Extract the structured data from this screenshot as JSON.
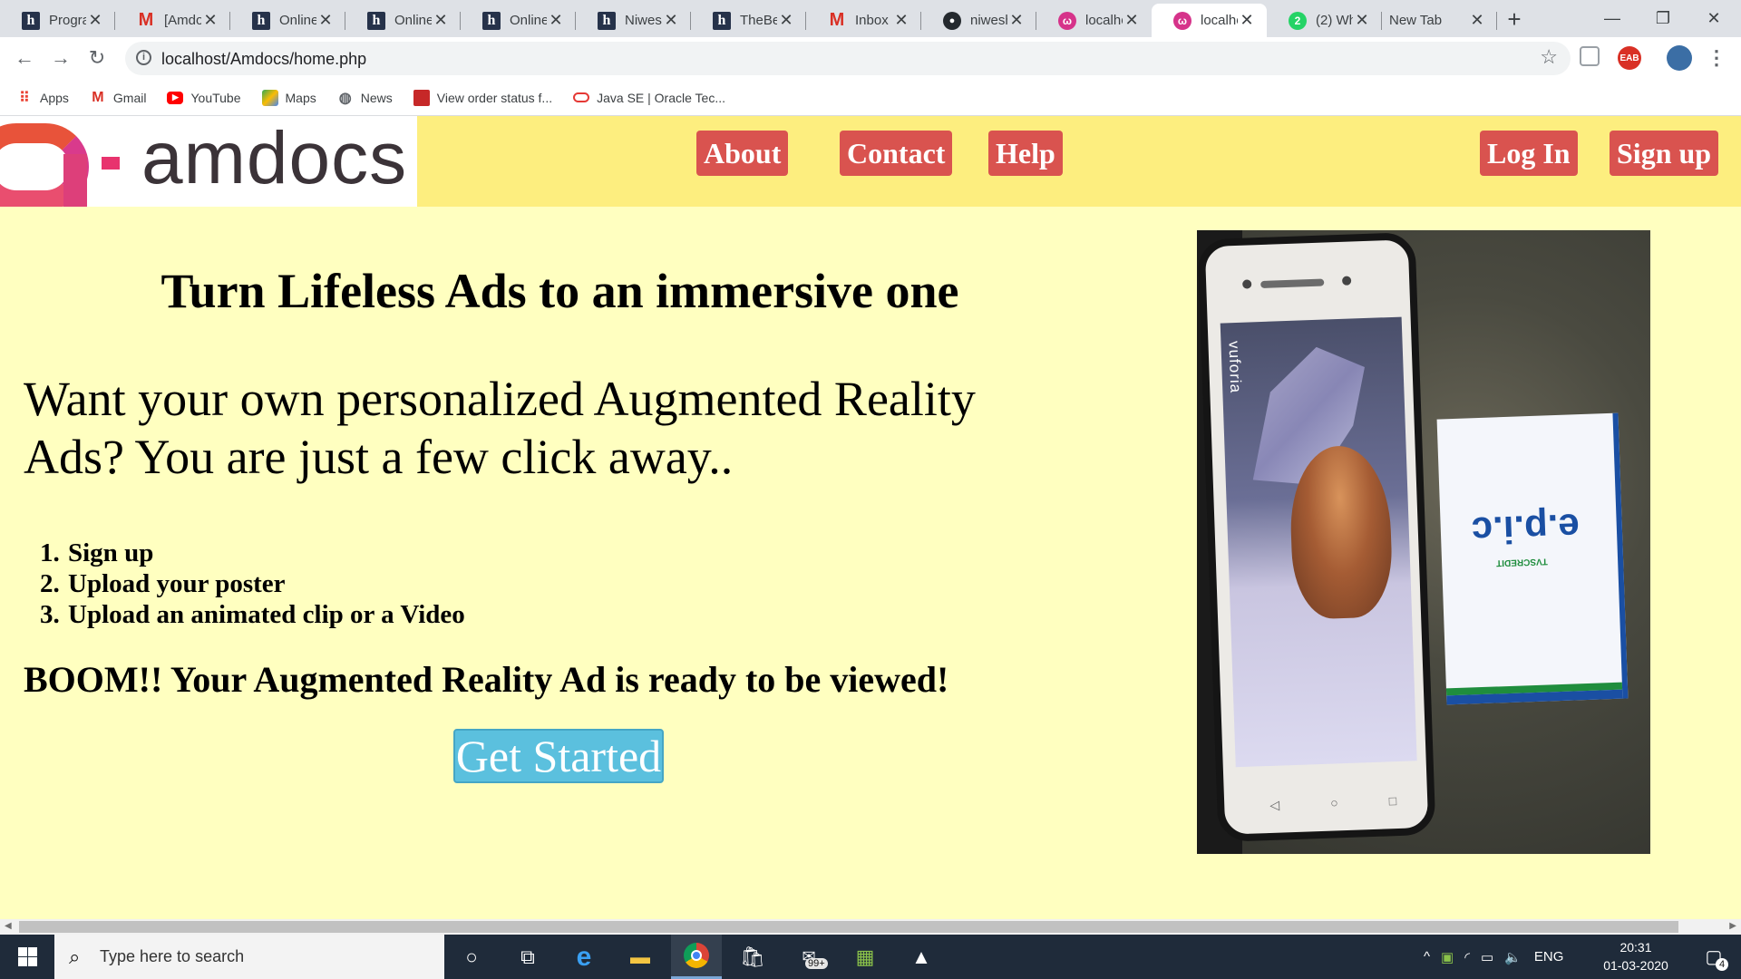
{
  "browser": {
    "tabs": [
      {
        "title": "Programming",
        "icon": "hackerearth-icon"
      },
      {
        "title": "[Amdocs",
        "icon": "gmail-icon"
      },
      {
        "title": "Online",
        "icon": "hackerearth-icon"
      },
      {
        "title": "Online",
        "icon": "hackerearth-icon"
      },
      {
        "title": "Online",
        "icon": "hackerearth-icon"
      },
      {
        "title": "Niwesh",
        "icon": "hackerearth-icon"
      },
      {
        "title": "TheBe",
        "icon": "hackerearth-icon"
      },
      {
        "title": "Inbox (",
        "icon": "gmail-icon"
      },
      {
        "title": "niwesh",
        "icon": "github-icon"
      },
      {
        "title": "localho",
        "icon": "localhost-icon"
      },
      {
        "title": "localho",
        "icon": "localhost-icon"
      },
      {
        "title": "(2) Wh",
        "icon": "whatsapp-icon"
      },
      {
        "title": "New Tab",
        "icon": ""
      }
    ],
    "active_tab_index": 10,
    "url": "localhost/Amdocs/home.php",
    "bookmarks": [
      {
        "label": "Apps",
        "icon": "apps-grid-icon"
      },
      {
        "label": "Gmail",
        "icon": "gmail-icon"
      },
      {
        "label": "YouTube",
        "icon": "youtube-icon"
      },
      {
        "label": "Maps",
        "icon": "maps-icon"
      },
      {
        "label": "News",
        "icon": "globe-icon"
      },
      {
        "label": "View order status f...",
        "icon": "order-icon"
      },
      {
        "label": "Java SE | Oracle Tec...",
        "icon": "oracle-icon"
      }
    ],
    "badge_wh": "2",
    "ext_label": "EAB"
  },
  "site": {
    "logo_text": "amdocs",
    "nav": {
      "about": "About",
      "contact": "Contact",
      "help": "Help",
      "login": "Log In",
      "signup": "Sign up"
    },
    "headline": "Turn Lifeless Ads to an immersive one",
    "lead": "Want your own personalized Augmented Reality Ads? You are just a few click away..",
    "steps": [
      {
        "num": "1.",
        "text": "Sign up"
      },
      {
        "num": "2.",
        "text": "Upload your poster"
      },
      {
        "num": "3.",
        "text": "Upload an animated clip or a Video"
      }
    ],
    "boom": "BOOM!! Your Augmented Reality Ad is ready to be viewed!",
    "cta": "Get Started",
    "photo": {
      "screen_watermark": "vuforia",
      "booklet_brand": "e.p.i.c",
      "booklet_sub": "TVSCREDIT"
    },
    "colors": {
      "header_bg": "#fdee7f",
      "page_bg": "#ffffc0",
      "nav_button": "#d9534f",
      "cta_button": "#5bc0de"
    }
  },
  "taskbar": {
    "search_placeholder": "Type here to search",
    "mail_badge": "99+",
    "lang": "ENG",
    "time": "20:31",
    "date": "01-03-2020",
    "notif_count": "4"
  }
}
